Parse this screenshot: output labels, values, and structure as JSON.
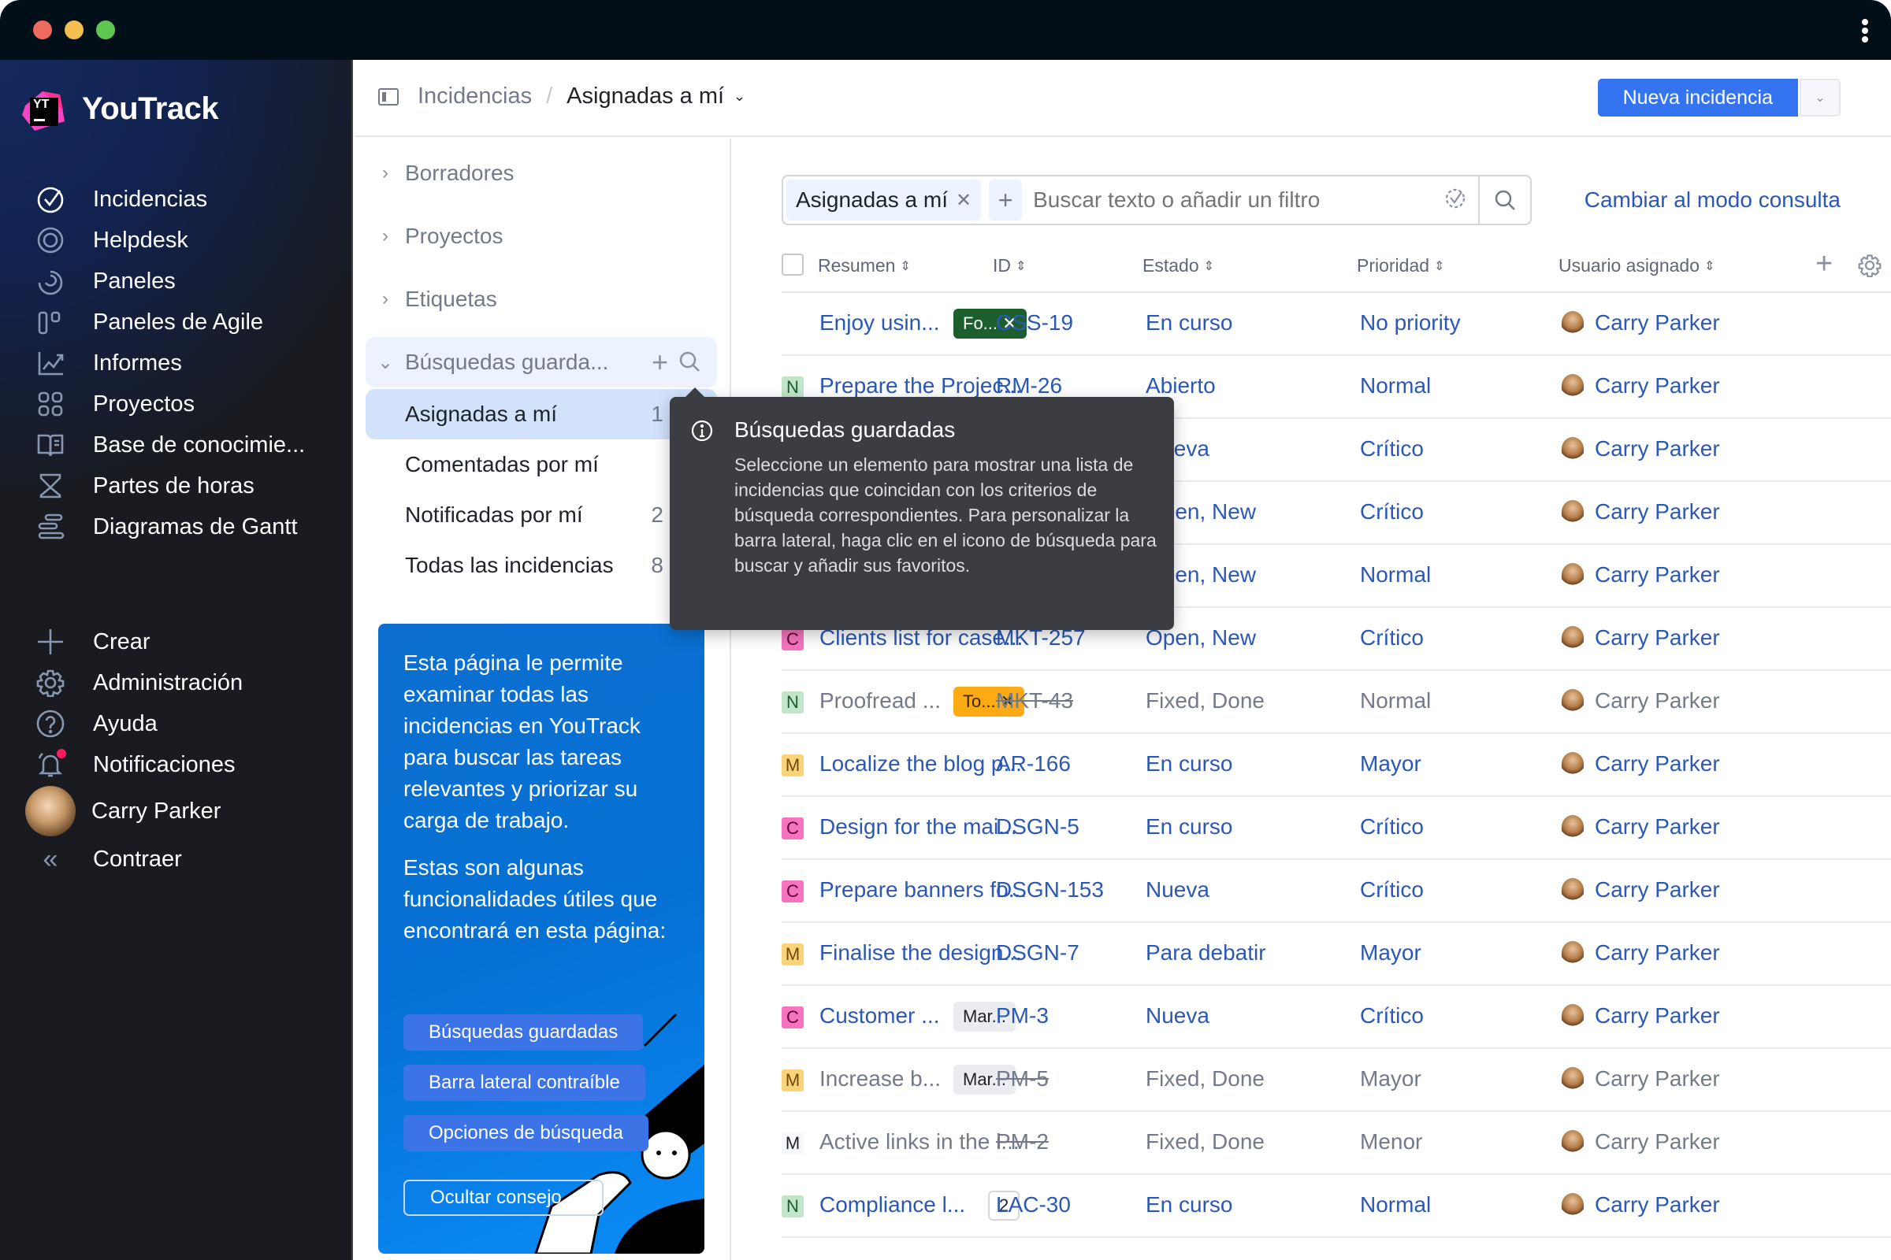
{
  "window": {
    "controls": [
      "close",
      "minimize",
      "maximize"
    ],
    "menu_icon": "kebab-icon"
  },
  "app": {
    "name": "YouTrack",
    "logo_text": "YT"
  },
  "nav": {
    "items": [
      {
        "label": "Incidencias",
        "icon": "check-circle-icon"
      },
      {
        "label": "Helpdesk",
        "icon": "lifebuoy-icon"
      },
      {
        "label": "Paneles",
        "icon": "dashboard-icon"
      },
      {
        "label": "Paneles de Agile",
        "icon": "agile-board-icon"
      },
      {
        "label": "Informes",
        "icon": "chart-icon"
      },
      {
        "label": "Proyectos",
        "icon": "projects-grid-icon"
      },
      {
        "label": "Base de conocimie...",
        "icon": "book-icon"
      },
      {
        "label": "Partes de horas",
        "icon": "hourglass-icon"
      },
      {
        "label": "Diagramas de Gantt",
        "icon": "gantt-icon"
      }
    ],
    "bottom": [
      {
        "label": "Crear",
        "icon": "plus-icon"
      },
      {
        "label": "Administración",
        "icon": "gear-icon"
      },
      {
        "label": "Ayuda",
        "icon": "help-icon"
      },
      {
        "label": "Notificaciones",
        "icon": "bell-icon"
      }
    ],
    "user": "Carry Parker",
    "collapse": "Contraer"
  },
  "header": {
    "breadcrumb_root": "Incidencias",
    "breadcrumb_sep": "/",
    "breadcrumb_current": "Asignadas a mí",
    "new_button": "Nueva incidencia"
  },
  "sidebar": {
    "groups": [
      "Borradores",
      "Proyectos",
      "Etiquetas"
    ],
    "saved_header": "Búsquedas guarda...",
    "saved": [
      {
        "label": "Asignadas a mí",
        "count": "1"
      },
      {
        "label": "Comentadas por mí",
        "count": ""
      },
      {
        "label": "Notificadas por mí",
        "count": "2"
      },
      {
        "label": "Todas las incidencias",
        "count": "8"
      }
    ],
    "promo": {
      "text1": "Esta página le permite examinar todas las incidencias en YouTrack para buscar las tareas relevantes y priorizar su carga de trabajo.",
      "text2": "Estas son algunas funcionalidades útiles que encontrará en esta página:",
      "pills": [
        "Búsquedas guardadas",
        "Barra lateral contraíble",
        "Opciones de búsqueda"
      ],
      "hide_button": "Ocultar consejo"
    }
  },
  "search": {
    "chip": "Asignadas a mí",
    "placeholder": "Buscar texto o añadir un filtro",
    "query_mode_link": "Cambiar al modo consulta"
  },
  "table": {
    "columns": [
      "Resumen",
      "ID",
      "Estado",
      "Prioridad",
      "Usuario asignado"
    ],
    "rows": [
      {
        "tag": "",
        "summary": "Enjoy usin...",
        "badge": "Fo... ✕",
        "badge_style": "green",
        "id": "CSS-19",
        "state": "En curso",
        "priority": "No priority",
        "assignee": "Carry Parker",
        "resolved": false
      },
      {
        "tag": "N",
        "summary": "Prepare the Projec...",
        "badge": "",
        "id": "RM-26",
        "state": "Abierto",
        "priority": "Normal",
        "assignee": "Carry Parker",
        "resolved": false
      },
      {
        "tag": "",
        "summary": "",
        "badge": "",
        "id": "",
        "state": "Nueva",
        "priority": "Crítico",
        "assignee": "Carry Parker",
        "resolved": false
      },
      {
        "tag": "",
        "summary": "",
        "badge": "",
        "id": "",
        "state": "Open, New",
        "priority": "Crítico",
        "assignee": "Carry Parker",
        "resolved": false
      },
      {
        "tag": "",
        "summary": "",
        "badge": "",
        "id": "",
        "state": "Open, New",
        "priority": "Normal",
        "assignee": "Carry Parker",
        "resolved": false
      },
      {
        "tag": "C",
        "summary": "Clients list for case...",
        "badge": "",
        "id": "MKT-257",
        "state": "Open, New",
        "priority": "Crítico",
        "assignee": "Carry Parker",
        "resolved": false
      },
      {
        "tag": "N",
        "summary": "Proofread ...",
        "badge": "To... ✕",
        "badge_style": "orange",
        "id": "MKT-43",
        "state": "Fixed, Done",
        "priority": "Normal",
        "assignee": "Carry Parker",
        "resolved": true
      },
      {
        "tag": "M",
        "summary": "Localize the blog p...",
        "badge": "",
        "id": "AR-166",
        "state": "En curso",
        "priority": "Mayor",
        "assignee": "Carry Parker",
        "resolved": false
      },
      {
        "tag": "C",
        "summary": "Design for the mai...",
        "badge": "",
        "id": "DSGN-5",
        "state": "En curso",
        "priority": "Crítico",
        "assignee": "Carry Parker",
        "resolved": false
      },
      {
        "tag": "C",
        "summary": "Prepare banners fo...",
        "badge": "",
        "id": "DSGN-153",
        "state": "Nueva",
        "priority": "Crítico",
        "assignee": "Carry Parker",
        "resolved": false
      },
      {
        "tag": "M",
        "summary": "Finalise the design...",
        "badge": "",
        "id": "DSGN-7",
        "state": "Para debatir",
        "priority": "Mayor",
        "assignee": "Carry Parker",
        "resolved": false
      },
      {
        "tag": "C",
        "summary": "Customer ...",
        "badge": "Mar...",
        "badge_style": "grey",
        "id": "PM-3",
        "state": "Nueva",
        "priority": "Crítico",
        "assignee": "Carry Parker",
        "resolved": false
      },
      {
        "tag": "M",
        "summary": "Increase b...",
        "badge": "Mar...",
        "badge_style": "grey",
        "id": "PM-5",
        "state": "Fixed, Done",
        "priority": "Mayor",
        "assignee": "Carry Parker",
        "resolved": true
      },
      {
        "tag": "M",
        "tag_style": "plain",
        "summary": "Active links in the i...",
        "badge": "",
        "id": "PM-2",
        "state": "Fixed, Done",
        "priority": "Menor",
        "assignee": "Carry Parker",
        "resolved": true
      },
      {
        "tag": "N",
        "summary": "Compliance l...",
        "badge": "2",
        "badge_style": "outline",
        "id": "LAC-30",
        "state": "En curso",
        "priority": "Normal",
        "assignee": "Carry Parker",
        "resolved": false
      }
    ]
  },
  "tooltip": {
    "title": "Búsquedas guardadas",
    "body": "Seleccione un elemento para mostrar una lista de incidencias que coincidan con los criterios de búsqueda correspondientes. Para personalizar la barra lateral, haga clic en el icono de búsqueda para buscar y añadir sus favoritos."
  },
  "colors": {
    "accent": "#3574f0",
    "link": "#2b58b6",
    "tag_N": "#c2e5cb",
    "tag_M": "#fdd37a",
    "tag_C": "#f573bf",
    "badge_green": "#1c5e2c",
    "badge_orange": "#fdab14",
    "notification_dot": "#ff1a5f"
  }
}
